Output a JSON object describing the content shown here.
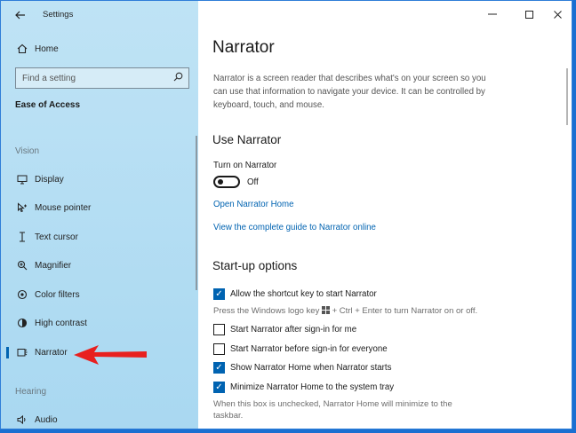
{
  "window": {
    "title": "Settings"
  },
  "sidebar": {
    "home_label": "Home",
    "search_placeholder": "Find a setting",
    "section_title": "Ease of Access",
    "groups": [
      {
        "heading": "Vision"
      },
      {
        "heading": "Hearing"
      }
    ],
    "items": [
      {
        "label": "Display",
        "icon": "monitor-icon"
      },
      {
        "label": "Mouse pointer",
        "icon": "mouse-pointer-icon"
      },
      {
        "label": "Text cursor",
        "icon": "text-cursor-icon"
      },
      {
        "label": "Magnifier",
        "icon": "magnifier-icon"
      },
      {
        "label": "Color filters",
        "icon": "color-filters-icon"
      },
      {
        "label": "High contrast",
        "icon": "high-contrast-icon"
      },
      {
        "label": "Narrator",
        "icon": "narrator-icon",
        "selected": true
      },
      {
        "label": "Audio",
        "icon": "audio-icon"
      }
    ]
  },
  "main": {
    "title": "Narrator",
    "description": "Narrator is a screen reader that describes what's on your screen so you can use that information to navigate your device. It can be controlled by keyboard, touch, and mouse.",
    "use_narrator": {
      "heading": "Use Narrator",
      "toggle_label": "Turn on Narrator",
      "toggle_state": "Off",
      "link_home": "Open Narrator Home",
      "link_guide": "View the complete guide to Narrator online"
    },
    "startup": {
      "heading": "Start-up options",
      "options": [
        {
          "label": "Allow the shortcut key to start Narrator",
          "checked": true
        },
        {
          "label": "Start Narrator after sign-in for me",
          "checked": false
        },
        {
          "label": "Start Narrator before sign-in for everyone",
          "checked": false
        },
        {
          "label": "Show Narrator Home when Narrator starts",
          "checked": true
        },
        {
          "label": "Minimize Narrator Home to the system tray",
          "checked": true
        }
      ],
      "shortcut_hint_before": "Press the Windows logo key",
      "shortcut_hint_after": "+ Ctrl + Enter to turn Narrator on or off.",
      "minimize_hint": "When this box is unchecked, Narrator Home will minimize to the taskbar."
    }
  },
  "colors": {
    "accent": "#0063b1",
    "sidebar_bg": "#bfe3f5",
    "desktop": "#1a6fd1",
    "arrow": "#e8201f"
  }
}
